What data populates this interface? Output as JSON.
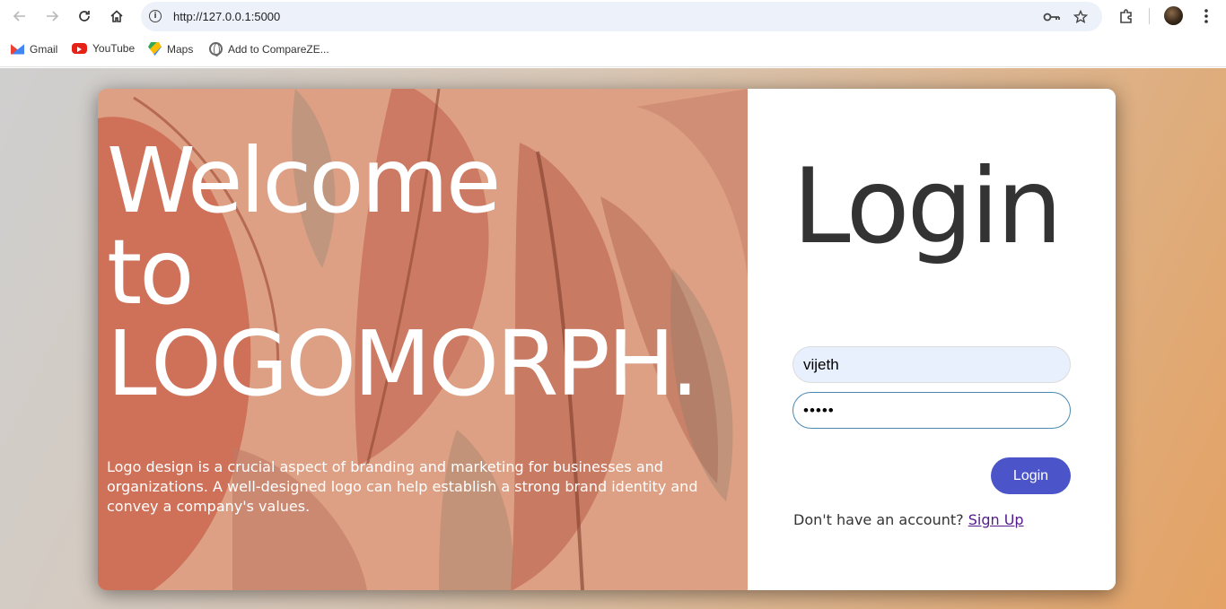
{
  "browser": {
    "url": "http://127.0.0.1:5000",
    "bookmarks": [
      {
        "label": "Gmail",
        "icon": "gmail-icon"
      },
      {
        "label": "YouTube",
        "icon": "youtube-icon"
      },
      {
        "label": "Maps",
        "icon": "maps-icon"
      },
      {
        "label": "Add to CompareZE...",
        "icon": "globe-icon"
      }
    ]
  },
  "hero": {
    "title_line1": "Welcome",
    "title_line2": "to",
    "title_line3": "LOGOMORPH.",
    "description": "Logo design is a crucial aspect of branding and marketing for businesses and organizations. A well-designed logo can help establish a strong brand identity and convey a company's values."
  },
  "login": {
    "title": "Login",
    "username_value": "vijeth",
    "password_value": "•••••",
    "button_label": "Login",
    "signup_prompt": "Don't have an account?",
    "signup_link": "Sign Up"
  },
  "colors": {
    "accent": "#4b55c9",
    "hero_overlay": "#d99d82",
    "title_text": "#333333"
  }
}
